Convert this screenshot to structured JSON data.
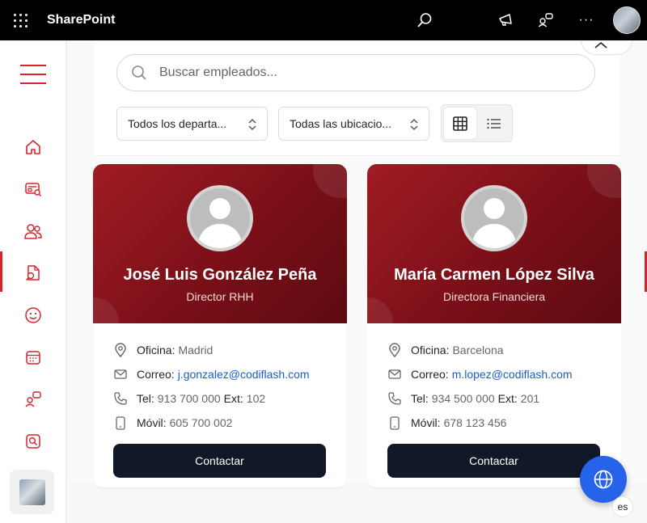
{
  "app": {
    "title": "SharePoint"
  },
  "topbar": {
    "icons": [
      "waffle-icon",
      "search-icon",
      "megaphone-icon",
      "people-chat-icon",
      "more-icon",
      "avatar"
    ],
    "more_label": "···"
  },
  "rail": {
    "items": [
      {
        "name": "home-icon"
      },
      {
        "name": "news-icon"
      },
      {
        "name": "people-icon",
        "active": true
      },
      {
        "name": "document-search-icon"
      },
      {
        "name": "smiley-icon"
      },
      {
        "name": "calendar-icon"
      },
      {
        "name": "chat-icon"
      },
      {
        "name": "search-box-icon"
      }
    ]
  },
  "search": {
    "placeholder": "Buscar empleados..."
  },
  "filters": {
    "department": "Todos los departa...",
    "location": "Todas las ubicacio..."
  },
  "employees": [
    {
      "name": "José Luis González Peña",
      "role": "Director RHH",
      "office_label": "Oficina:",
      "office": "Madrid",
      "email_label": "Correo:",
      "email": "j.gonzalez@codiflash.com",
      "tel_label": "Tel:",
      "tel": "913 700 000",
      "ext_label": "Ext:",
      "ext": "102",
      "mobile_label": "Móvil:",
      "mobile": "605 700 002",
      "button": "Contactar"
    },
    {
      "name": "María Carmen López Silva",
      "role": "Directora Financiera",
      "office_label": "Oficina:",
      "office": "Barcelona",
      "email_label": "Correo:",
      "email": "m.lopez@codiflash.com",
      "tel_label": "Tel:",
      "tel": "934 500 000",
      "ext_label": "Ext:",
      "ext": "201",
      "mobile_label": "Móvil:",
      "mobile": "678 123 456",
      "button": "Contactar"
    }
  ],
  "language": {
    "code": "es"
  },
  "colors": {
    "accent": "#d7232b",
    "card_header": "#8b141d",
    "button": "#111827",
    "link": "#1a5fc4",
    "fab": "#2563eb"
  }
}
